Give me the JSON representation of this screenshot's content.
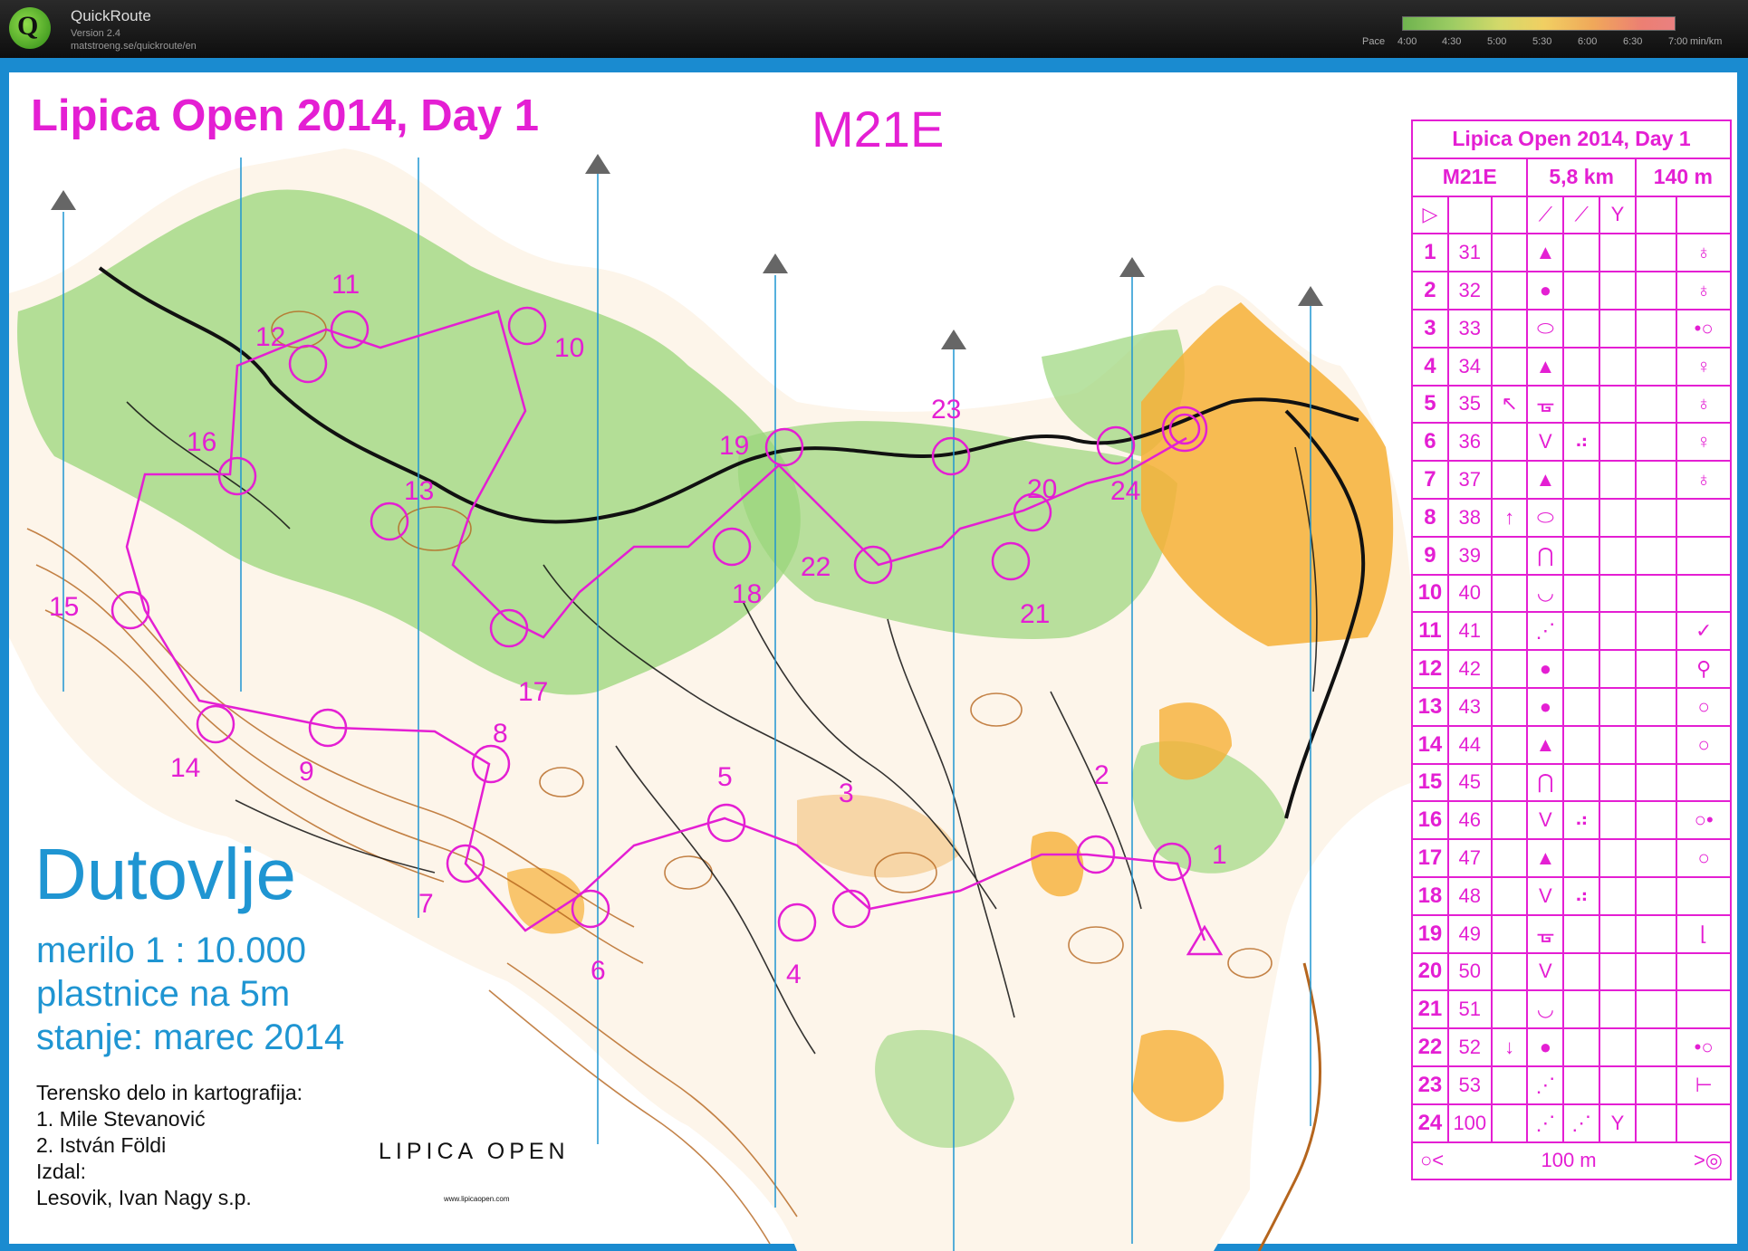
{
  "app": {
    "name": "QuickRoute",
    "version": "Version 2.4",
    "url": "matstroeng.se/quickroute/en"
  },
  "pace_scale": {
    "label": "Pace",
    "ticks": [
      "4:00",
      "4:30",
      "5:00",
      "5:30",
      "6:00",
      "6:30",
      "7:00"
    ],
    "unit": "min/km"
  },
  "map": {
    "event_title": "Lipica Open 2014, Day 1",
    "class": "M21E",
    "place": "Dutovlje",
    "scale_lines": [
      "merilo 1 : 10.000",
      "plastnice na 5m",
      "stanje: marec 2014"
    ],
    "credits": [
      "Terensko delo in kartografija:",
      "1. Mile Stevanović",
      "2. István Földi",
      "Izdal:",
      "Lesovik, Ivan Nagy s.p."
    ],
    "sponsor_logo": "LIPICA OPEN",
    "sponsor_url": "www.lipicaopen.com",
    "control_numbers": [
      "1",
      "2",
      "3",
      "4",
      "5",
      "6",
      "7",
      "8",
      "9",
      "10",
      "11",
      "12",
      "13",
      "14",
      "15",
      "16",
      "17",
      "18",
      "19",
      "20",
      "21",
      "22",
      "23",
      "24"
    ],
    "colors": {
      "course": "#e41fd3",
      "north_lines": "#1f95d2",
      "vegetation": "#8fd06a",
      "open_land": "#f6b037",
      "contours": "#b5651d",
      "frame": "#1a8bd0"
    }
  },
  "description_sheet": {
    "title": "Lipica Open 2014, Day 1",
    "class": "M21E",
    "length": "5,8 km",
    "climb": "140 m",
    "start_symbols": [
      "start-triangle",
      "⟋",
      "⟋",
      "Y"
    ],
    "controls": [
      {
        "num": "1",
        "code": "31",
        "c": "",
        "d": "▲",
        "e": "",
        "f": "",
        "h": "♁"
      },
      {
        "num": "2",
        "code": "32",
        "c": "",
        "d": "●",
        "e": "",
        "f": "",
        "h": "♁"
      },
      {
        "num": "3",
        "code": "33",
        "c": "",
        "d": "⬭",
        "e": "",
        "f": "",
        "h": "•○"
      },
      {
        "num": "4",
        "code": "34",
        "c": "",
        "d": "▲",
        "e": "",
        "f": "",
        "h": "♀"
      },
      {
        "num": "5",
        "code": "35",
        "c": "↖",
        "d": "ᚗ",
        "e": "",
        "f": "",
        "h": "♁"
      },
      {
        "num": "6",
        "code": "36",
        "c": "",
        "d": "V",
        "e": "⠴",
        "f": "",
        "h": "♀"
      },
      {
        "num": "7",
        "code": "37",
        "c": "",
        "d": "▲",
        "e": "",
        "f": "",
        "h": "♁"
      },
      {
        "num": "8",
        "code": "38",
        "c": "↑",
        "d": "⬭",
        "e": "",
        "f": "",
        "h": ""
      },
      {
        "num": "9",
        "code": "39",
        "c": "",
        "d": "⋂",
        "e": "",
        "f": "",
        "h": ""
      },
      {
        "num": "10",
        "code": "40",
        "c": "",
        "d": "◡",
        "e": "",
        "f": "",
        "h": ""
      },
      {
        "num": "11",
        "code": "41",
        "c": "",
        "d": "⋰",
        "e": "",
        "f": "",
        "h": "✓"
      },
      {
        "num": "12",
        "code": "42",
        "c": "",
        "d": "●",
        "e": "",
        "f": "",
        "h": "⚲"
      },
      {
        "num": "13",
        "code": "43",
        "c": "",
        "d": "●",
        "e": "",
        "f": "",
        "h": "○"
      },
      {
        "num": "14",
        "code": "44",
        "c": "",
        "d": "▲",
        "e": "",
        "f": "",
        "h": "○"
      },
      {
        "num": "15",
        "code": "45",
        "c": "",
        "d": "⋂",
        "e": "",
        "f": "",
        "h": ""
      },
      {
        "num": "16",
        "code": "46",
        "c": "",
        "d": "V",
        "e": "⠴",
        "f": "",
        "h": "○•"
      },
      {
        "num": "17",
        "code": "47",
        "c": "",
        "d": "▲",
        "e": "",
        "f": "",
        "h": "○"
      },
      {
        "num": "18",
        "code": "48",
        "c": "",
        "d": "V",
        "e": "⠴",
        "f": "",
        "h": ""
      },
      {
        "num": "19",
        "code": "49",
        "c": "",
        "d": "ᚗ",
        "e": "",
        "f": "",
        "h": "⌊"
      },
      {
        "num": "20",
        "code": "50",
        "c": "",
        "d": "V",
        "e": "",
        "f": "",
        "h": ""
      },
      {
        "num": "21",
        "code": "51",
        "c": "",
        "d": "◡",
        "e": "",
        "f": "",
        "h": ""
      },
      {
        "num": "22",
        "code": "52",
        "c": "↓",
        "d": "●",
        "e": "",
        "f": "",
        "h": "•○"
      },
      {
        "num": "23",
        "code": "53",
        "c": "",
        "d": "⋰",
        "e": "",
        "f": "",
        "h": "⊢"
      },
      {
        "num": "24",
        "code": "100",
        "c": "",
        "d": "⋰",
        "e": "⋰",
        "f": "Y",
        "h": ""
      }
    ],
    "finish_distance": "100 m"
  }
}
